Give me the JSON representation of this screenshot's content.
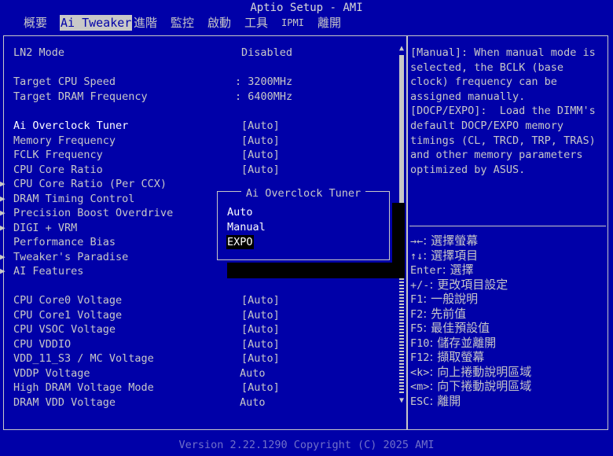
{
  "title": "Aptio Setup - AMI",
  "tabs": [
    {
      "label": "概要"
    },
    {
      "label": "Ai Tweaker"
    },
    {
      "label": "進階"
    },
    {
      "label": "監控"
    },
    {
      "label": "啟動"
    },
    {
      "label": "工具"
    },
    {
      "label": "IPMI"
    },
    {
      "label": "離開"
    }
  ],
  "active_tab": "Ai Tweaker",
  "settings": [
    {
      "label": "LN2 Mode",
      "value": "Disabled"
    },
    {
      "label": "Target CPU Speed",
      "value": ": 3200MHz"
    },
    {
      "label": "Target DRAM Frequency",
      "value": ": 6400MHz"
    },
    {
      "label": "Ai Overclock Tuner",
      "value": "[Auto]"
    },
    {
      "label": "Memory Frequency",
      "value": "[Auto]"
    },
    {
      "label": "FCLK Frequency",
      "value": "[Auto]"
    },
    {
      "label": "CPU Core Ratio",
      "value": "[Auto]"
    },
    {
      "label": "CPU Core Ratio (Per CCX)",
      "value": ""
    },
    {
      "label": "DRAM Timing Control",
      "value": ""
    },
    {
      "label": "Precision Boost Overdrive",
      "value": ""
    },
    {
      "label": "DIGI + VRM",
      "value": ""
    },
    {
      "label": "Performance Bias",
      "value": ""
    },
    {
      "label": "Tweaker's Paradise",
      "value": ""
    },
    {
      "label": "AI Features",
      "value": ""
    },
    {
      "label": "CPU Core0 Voltage",
      "value": "[Auto]"
    },
    {
      "label": "CPU Core1 Voltage",
      "value": "[Auto]"
    },
    {
      "label": "CPU VSOC Voltage",
      "value": "[Auto]"
    },
    {
      "label": "CPU VDDIO",
      "value": "[Auto]"
    },
    {
      "label": "VDD_11_S3 / MC Voltage",
      "value": "[Auto]"
    },
    {
      "label": "VDDP Voltage",
      "value": "Auto"
    },
    {
      "label": "High DRAM Voltage Mode",
      "value": "[Auto]"
    },
    {
      "label": "DRAM VDD Voltage",
      "value": "Auto"
    }
  ],
  "help_text": "[Manual]: When manual mode is\nselected, the BCLK (base\nclock) frequency can be\nassigned manually.\n[DOCP/EXPO]:  Load the DIMM's\ndefault DOCP/EXPO memory\ntimings (CL, TRCD, TRP, TRAS)\nand other memory parameters\noptimized by ASUS.",
  "keys": [
    {
      "key": "→←",
      "desc": ": 選擇螢幕"
    },
    {
      "key": "↑↓",
      "desc": ": 選擇項目"
    },
    {
      "key": "Enter",
      "desc": ": 選擇"
    },
    {
      "key": "+/-",
      "desc": ": 更改項目設定"
    },
    {
      "key": "F1",
      "desc": ": 一般說明"
    },
    {
      "key": "F2",
      "desc": ": 先前值"
    },
    {
      "key": "F5",
      "desc": ": 最佳預設值"
    },
    {
      "key": "F10",
      "desc": ": 儲存並離開"
    },
    {
      "key": "F12",
      "desc": ": 擷取螢幕"
    },
    {
      "key": "<k>",
      "desc": ": 向上捲動說明區域"
    },
    {
      "key": "<m>",
      "desc": ": 向下捲動說明區域"
    },
    {
      "key": "ESC",
      "desc": ": 離開"
    }
  ],
  "popup": {
    "title": "Ai Overclock Tuner",
    "options": [
      "Auto",
      "Manual",
      "EXPO"
    ],
    "selected": "EXPO"
  },
  "scroll_icons": {
    "up": "triangle-up-icon",
    "down": "triangle-down-icon"
  },
  "footer": "Version 2.22.1290 Copyright (C) 2025 AMI",
  "colors": {
    "background": "#0000a8",
    "text": "#c8c8c8",
    "highlight": "#ffffff",
    "selection": "#000000",
    "footer": "#7070c8"
  }
}
